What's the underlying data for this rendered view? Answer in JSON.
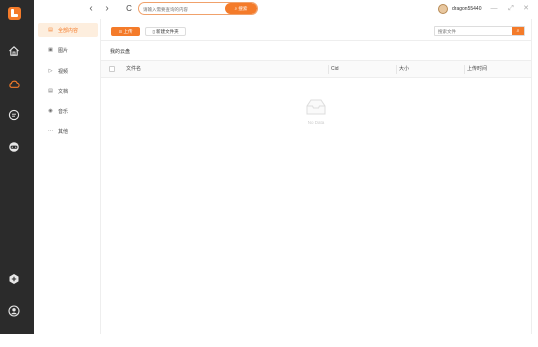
{
  "app": {
    "brand_color": "#f47b2a",
    "rail_color": "#2b2b2b"
  },
  "topbar": {
    "back_icon": "chevron-left-icon",
    "forward_icon": "chevron-right-icon",
    "refresh_label": "C",
    "search_placeholder": "请输入需要查询的内容",
    "search_button": "搜索",
    "username": "dragon55440",
    "minimize": "—",
    "maximize": "⤢",
    "close": "✕"
  },
  "rail": {
    "icons": [
      "logo-icon",
      "home-icon",
      "cloud-icon",
      "chat-icon",
      "game-icon",
      "plugin-icon",
      "user-icon"
    ]
  },
  "sidebar": {
    "items": [
      {
        "label": "全部内容",
        "icon": "▤",
        "active": true
      },
      {
        "label": "图片",
        "icon": "▣"
      },
      {
        "label": "视频",
        "icon": "▷"
      },
      {
        "label": "文档",
        "icon": "▤"
      },
      {
        "label": "音乐",
        "icon": "◉"
      },
      {
        "label": "其他",
        "icon": "···"
      }
    ]
  },
  "main": {
    "upload_label": "上传",
    "new_folder_label": "新建文件夹",
    "search_placeholder": "搜索文件",
    "breadcrumb": "我的云盘",
    "columns": [
      "文件名",
      "Cid",
      "大小",
      "上传时间"
    ],
    "empty_text": "No Data"
  }
}
